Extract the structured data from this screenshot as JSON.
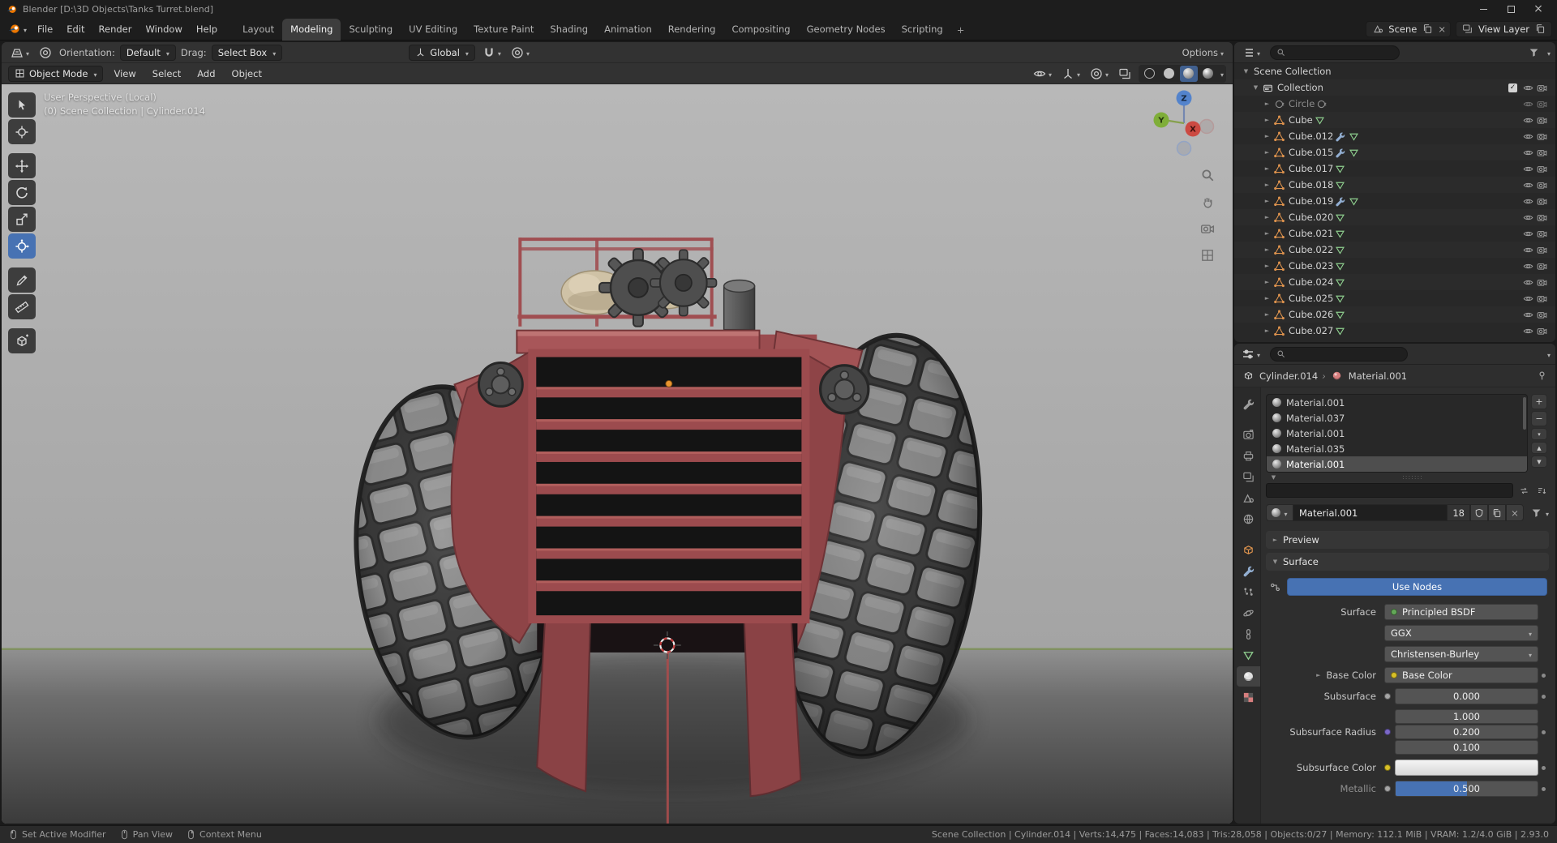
{
  "colors": {
    "accent_blue": "#4772b3",
    "header_bg": "#323232",
    "editor_bg": "#282828",
    "tank_red": "#9c4b4e",
    "origin_orange": "#e8952f"
  },
  "window": {
    "title": "Blender [D:\\3D Objects\\Tanks Turret.blend]"
  },
  "topbar": {
    "menus": [
      "File",
      "Edit",
      "Render",
      "Window",
      "Help"
    ],
    "workspaces": [
      "Layout",
      "Modeling",
      "Sculpting",
      "UV Editing",
      "Texture Paint",
      "Shading",
      "Animation",
      "Rendering",
      "Compositing",
      "Geometry Nodes",
      "Scripting"
    ],
    "active_workspace": "Modeling",
    "add_tab": "+",
    "scene_selector": "Scene",
    "view_layer_selector": "View Layer"
  },
  "tool_settings": {
    "orientation_label": "Orientation:",
    "orientation_value": "Default",
    "drag_label": "Drag:",
    "drag_value": "Select Box",
    "transform_orientation": "Global",
    "options_label": "Options"
  },
  "viewport_header": {
    "mode": "Object Mode",
    "menus": [
      "View",
      "Select",
      "Add",
      "Object"
    ]
  },
  "viewport": {
    "overlay_line1": "User Perspective (Local)",
    "overlay_line2": "(0) Scene Collection | Cylinder.014",
    "tools": [
      "select-box",
      "cursor",
      "move",
      "rotate",
      "scale",
      "transform",
      "annotate",
      "measure",
      "add-cube"
    ],
    "active_tool": "transform",
    "gizmo_axes": {
      "x": "X",
      "y": "Y",
      "z": "Z"
    }
  },
  "outliner": {
    "root_label": "Scene Collection",
    "collection_label": "Collection",
    "items": [
      {
        "label": "Circle",
        "dimmed": true,
        "icons": [
          "curve"
        ]
      },
      {
        "label": "Cube",
        "icons": [
          "mesh-data"
        ]
      },
      {
        "label": "Cube.012",
        "icons": [
          "modifier-wrench",
          "mesh-data"
        ]
      },
      {
        "label": "Cube.015",
        "icons": [
          "modifier-wrench",
          "mesh-data"
        ]
      },
      {
        "label": "Cube.017",
        "icons": [
          "mesh-data"
        ]
      },
      {
        "label": "Cube.018",
        "icons": [
          "mesh-data"
        ]
      },
      {
        "label": "Cube.019",
        "icons": [
          "modifier-wrench",
          "mesh-data"
        ]
      },
      {
        "label": "Cube.020",
        "icons": [
          "mesh-data"
        ]
      },
      {
        "label": "Cube.021",
        "icons": [
          "mesh-data"
        ]
      },
      {
        "label": "Cube.022",
        "icons": [
          "mesh-data"
        ]
      },
      {
        "label": "Cube.023",
        "icons": [
          "mesh-data"
        ]
      },
      {
        "label": "Cube.024",
        "icons": [
          "mesh-data"
        ]
      },
      {
        "label": "Cube.025",
        "icons": [
          "mesh-data"
        ]
      },
      {
        "label": "Cube.026",
        "icons": [
          "mesh-data"
        ]
      },
      {
        "label": "Cube.027",
        "icons": [
          "mesh-data"
        ]
      }
    ]
  },
  "properties": {
    "breadcrumb": {
      "object": "Cylinder.014",
      "material": "Material.001"
    },
    "tabs": [
      "tool",
      "render",
      "output",
      "view-layer",
      "scene",
      "world",
      "object",
      "modifiers",
      "particles",
      "physics",
      "constraints",
      "object-data",
      "material",
      "texture"
    ],
    "active_tab": "material",
    "slots": [
      {
        "name": "Material.001"
      },
      {
        "name": "Material.037"
      },
      {
        "name": "Material.001"
      },
      {
        "name": "Material.035"
      },
      {
        "name": "Material.001",
        "selected": true
      }
    ],
    "material_name": "Material.001",
    "user_count": "18",
    "panels": {
      "preview": "Preview",
      "surface": "Surface"
    },
    "use_nodes_label": "Use Nodes",
    "surface_row": {
      "label": "Surface",
      "value": "Principled BSDF"
    },
    "distribution": "GGX",
    "subsurface_method": "Christensen-Burley",
    "base_color": {
      "label": "Base Color",
      "value": "Base Color"
    },
    "subsurface": {
      "label": "Subsurface",
      "value": "0.000"
    },
    "subsurface_radius": {
      "label": "Subsurface Radius",
      "values": [
        "1.000",
        "0.200",
        "0.100"
      ]
    },
    "subsurface_color": {
      "label": "Subsurface Color"
    },
    "metallic": {
      "label": "Metallic",
      "value": "0.500",
      "fill_percent": 50
    }
  },
  "statusbar": {
    "hints": [
      {
        "icon": "mouse-left",
        "label": "Set Active Modifier"
      },
      {
        "icon": "mouse-middle",
        "label": "Pan View"
      },
      {
        "icon": "mouse-right",
        "label": "Context Menu"
      }
    ],
    "stats": "Scene Collection | Cylinder.014 | Verts:14,475 | Faces:14,083 | Tris:28,058 | Objects:0/27 | Memory: 112.1 MiB | VRAM: 1.2/4.0 GiB | 2.93.0"
  }
}
